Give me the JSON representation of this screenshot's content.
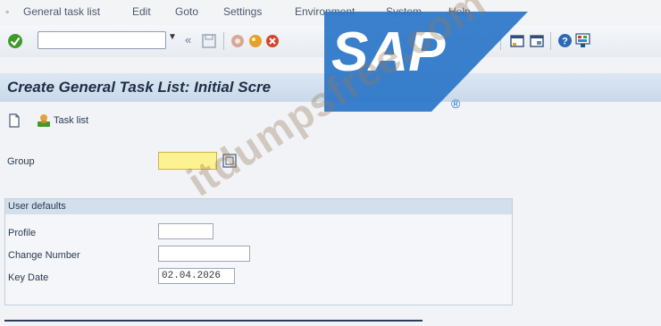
{
  "menu": {
    "items": [
      "General task list",
      "Edit",
      "Goto",
      "Settings",
      "Environment",
      "System",
      "Help"
    ]
  },
  "toolbar": {
    "command_field_value": "",
    "back_glyph": "«"
  },
  "title": "Create General Task List: Initial Scre",
  "app_toolbar": {
    "task_list_label": "Task list"
  },
  "form": {
    "group_label": "Group",
    "group_value": "",
    "user_defaults_title": "User defaults",
    "profile_label": "Profile",
    "profile_value": "",
    "change_number_label": "Change Number",
    "change_number_value": "",
    "key_date_label": "Key Date",
    "key_date_value": "02.04.2026"
  },
  "logo": {
    "text": "SAP",
    "registered": "®"
  },
  "watermark": "itdumpsfree.com",
  "colors": {
    "required_field": "#fdf291",
    "sap_blue": "#2a75c8",
    "title_bg": "#d4e1ef"
  },
  "icons": [
    "enter-check-icon",
    "back-icon",
    "save-icon",
    "exit-icon",
    "cancel-icon",
    "layout-icon",
    "help-icon",
    "customize-icon",
    "new-icon",
    "task-list-icon",
    "match-code-icon"
  ]
}
